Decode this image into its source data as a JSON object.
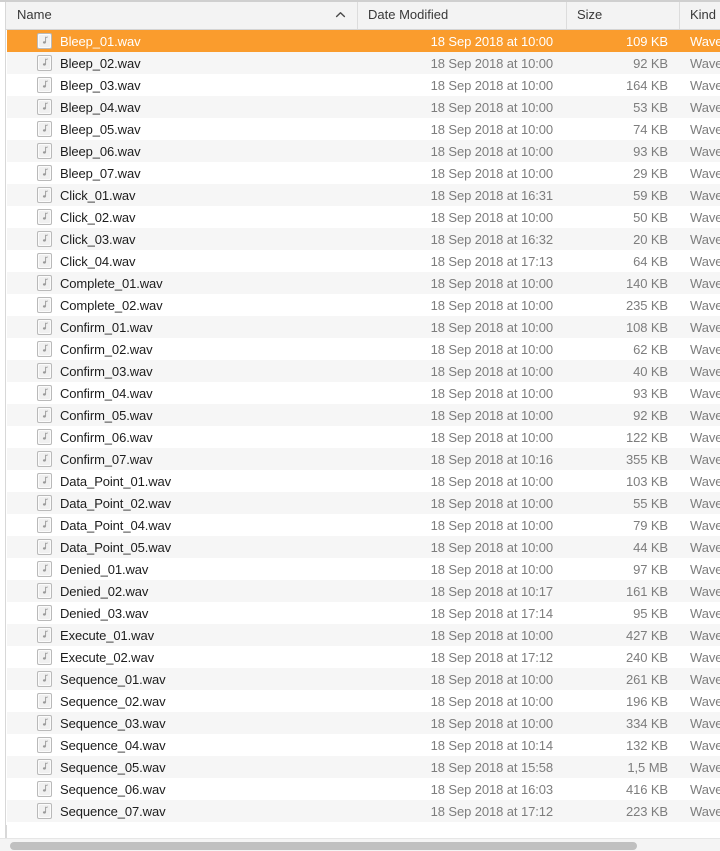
{
  "window": {
    "view_mode": "list-view",
    "accent_color": "#fa9c2d",
    "row_alt_color": "#f6f6f6",
    "header_background": "#f3f3f3",
    "secondary_text_color": "#7d7d7d"
  },
  "columns": [
    {
      "key": "name",
      "label": "Name",
      "sorted": true,
      "sort_direction": "ascending",
      "sort_icon": "chevron-up-icon"
    },
    {
      "key": "date",
      "label": "Date Modified",
      "sorted": false
    },
    {
      "key": "size",
      "label": "Size",
      "sorted": false
    },
    {
      "key": "kind",
      "label": "Kind",
      "sorted": false
    }
  ],
  "file_icon": "audio-file-icon",
  "selected_index": 0,
  "files": [
    {
      "name": "Bleep_01.wav",
      "date": "18 Sep 2018 at 10:00",
      "size": "109 KB",
      "kind": "Wave"
    },
    {
      "name": "Bleep_02.wav",
      "date": "18 Sep 2018 at 10:00",
      "size": "92 KB",
      "kind": "Wave"
    },
    {
      "name": "Bleep_03.wav",
      "date": "18 Sep 2018 at 10:00",
      "size": "164 KB",
      "kind": "Wave"
    },
    {
      "name": "Bleep_04.wav",
      "date": "18 Sep 2018 at 10:00",
      "size": "53 KB",
      "kind": "Wave"
    },
    {
      "name": "Bleep_05.wav",
      "date": "18 Sep 2018 at 10:00",
      "size": "74 KB",
      "kind": "Wave"
    },
    {
      "name": "Bleep_06.wav",
      "date": "18 Sep 2018 at 10:00",
      "size": "93 KB",
      "kind": "Wave"
    },
    {
      "name": "Bleep_07.wav",
      "date": "18 Sep 2018 at 10:00",
      "size": "29 KB",
      "kind": "Wave"
    },
    {
      "name": "Click_01.wav",
      "date": "18 Sep 2018 at 16:31",
      "size": "59 KB",
      "kind": "Wave"
    },
    {
      "name": "Click_02.wav",
      "date": "18 Sep 2018 at 10:00",
      "size": "50 KB",
      "kind": "Wave"
    },
    {
      "name": "Click_03.wav",
      "date": "18 Sep 2018 at 16:32",
      "size": "20 KB",
      "kind": "Wave"
    },
    {
      "name": "Click_04.wav",
      "date": "18 Sep 2018 at 17:13",
      "size": "64 KB",
      "kind": "Wave"
    },
    {
      "name": "Complete_01.wav",
      "date": "18 Sep 2018 at 10:00",
      "size": "140 KB",
      "kind": "Wave"
    },
    {
      "name": "Complete_02.wav",
      "date": "18 Sep 2018 at 10:00",
      "size": "235 KB",
      "kind": "Wave"
    },
    {
      "name": "Confirm_01.wav",
      "date": "18 Sep 2018 at 10:00",
      "size": "108 KB",
      "kind": "Wave"
    },
    {
      "name": "Confirm_02.wav",
      "date": "18 Sep 2018 at 10:00",
      "size": "62 KB",
      "kind": "Wave"
    },
    {
      "name": "Confirm_03.wav",
      "date": "18 Sep 2018 at 10:00",
      "size": "40 KB",
      "kind": "Wave"
    },
    {
      "name": "Confirm_04.wav",
      "date": "18 Sep 2018 at 10:00",
      "size": "93 KB",
      "kind": "Wave"
    },
    {
      "name": "Confirm_05.wav",
      "date": "18 Sep 2018 at 10:00",
      "size": "92 KB",
      "kind": "Wave"
    },
    {
      "name": "Confirm_06.wav",
      "date": "18 Sep 2018 at 10:00",
      "size": "122 KB",
      "kind": "Wave"
    },
    {
      "name": "Confirm_07.wav",
      "date": "18 Sep 2018 at 10:16",
      "size": "355 KB",
      "kind": "Wave"
    },
    {
      "name": "Data_Point_01.wav",
      "date": "18 Sep 2018 at 10:00",
      "size": "103 KB",
      "kind": "Wave"
    },
    {
      "name": "Data_Point_02.wav",
      "date": "18 Sep 2018 at 10:00",
      "size": "55 KB",
      "kind": "Wave"
    },
    {
      "name": "Data_Point_04.wav",
      "date": "18 Sep 2018 at 10:00",
      "size": "79 KB",
      "kind": "Wave"
    },
    {
      "name": "Data_Point_05.wav",
      "date": "18 Sep 2018 at 10:00",
      "size": "44 KB",
      "kind": "Wave"
    },
    {
      "name": "Denied_01.wav",
      "date": "18 Sep 2018 at 10:00",
      "size": "97 KB",
      "kind": "Wave"
    },
    {
      "name": "Denied_02.wav",
      "date": "18 Sep 2018 at 10:17",
      "size": "161 KB",
      "kind": "Wave"
    },
    {
      "name": "Denied_03.wav",
      "date": "18 Sep 2018 at 17:14",
      "size": "95 KB",
      "kind": "Wave"
    },
    {
      "name": "Execute_01.wav",
      "date": "18 Sep 2018 at 10:00",
      "size": "427 KB",
      "kind": "Wave"
    },
    {
      "name": "Execute_02.wav",
      "date": "18 Sep 2018 at 17:12",
      "size": "240 KB",
      "kind": "Wave"
    },
    {
      "name": "Sequence_01.wav",
      "date": "18 Sep 2018 at 10:00",
      "size": "261 KB",
      "kind": "Wave"
    },
    {
      "name": "Sequence_02.wav",
      "date": "18 Sep 2018 at 10:00",
      "size": "196 KB",
      "kind": "Wave"
    },
    {
      "name": "Sequence_03.wav",
      "date": "18 Sep 2018 at 10:00",
      "size": "334 KB",
      "kind": "Wave"
    },
    {
      "name": "Sequence_04.wav",
      "date": "18 Sep 2018 at 10:14",
      "size": "132 KB",
      "kind": "Wave"
    },
    {
      "name": "Sequence_05.wav",
      "date": "18 Sep 2018 at 15:58",
      "size": "1,5 MB",
      "kind": "Wave"
    },
    {
      "name": "Sequence_06.wav",
      "date": "18 Sep 2018 at 16:03",
      "size": "416 KB",
      "kind": "Wave"
    },
    {
      "name": "Sequence_07.wav",
      "date": "18 Sep 2018 at 17:12",
      "size": "223 KB",
      "kind": "Wave"
    }
  ],
  "scrollbar": {
    "orientation": "horizontal",
    "name": "horizontal-scrollbar"
  }
}
